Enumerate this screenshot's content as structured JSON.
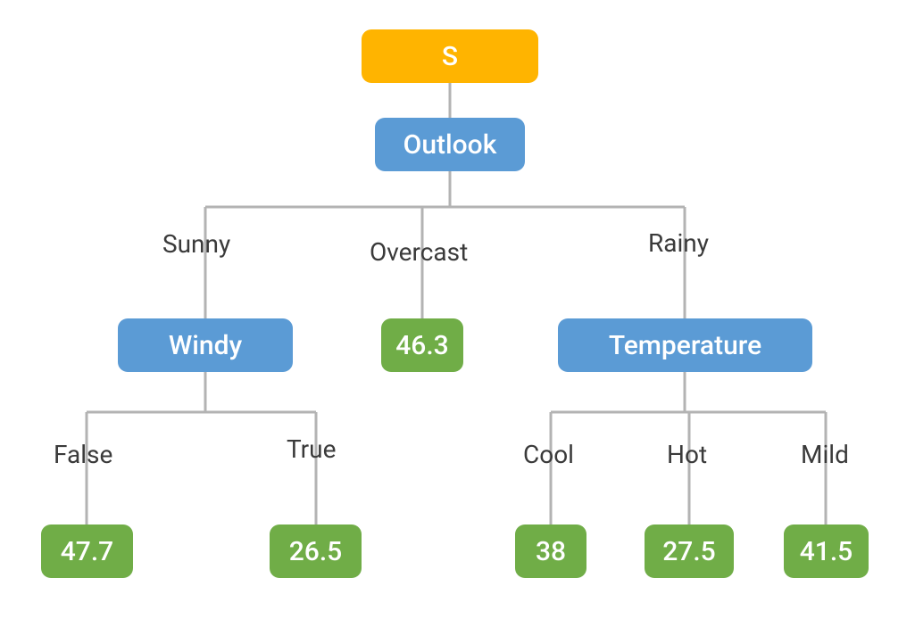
{
  "diagram": {
    "type": "decision-tree",
    "root": {
      "label": "S",
      "attribute": "Outlook",
      "branches": [
        {
          "value": "Sunny",
          "attribute": "Windy",
          "branches": [
            {
              "value": "False",
              "leaf": "47.7"
            },
            {
              "value": "True",
              "leaf": "26.5"
            }
          ]
        },
        {
          "value": "Overcast",
          "leaf": "46.3"
        },
        {
          "value": "Rainy",
          "attribute": "Temperature",
          "branches": [
            {
              "value": "Cool",
              "leaf": "38"
            },
            {
              "value": "Hot",
              "leaf": "27.5"
            },
            {
              "value": "Mild",
              "leaf": "41.5"
            }
          ]
        }
      ]
    }
  },
  "colors": {
    "root": "#ffb400",
    "attribute": "#5b9bd5",
    "leaf": "#70ad47",
    "edge": "#b3b3b3",
    "text_dark": "#3a3a3a",
    "text_light": "#ffffff"
  },
  "nodes": {
    "s_label": "S",
    "outlook_label": "Outlook",
    "windy_label": "Windy",
    "temperature_label": "Temperature",
    "overcast_leaf": "46.3",
    "windy_false_leaf": "47.7",
    "windy_true_leaf": "26.5",
    "temp_cool_leaf": "38",
    "temp_hot_leaf": "27.5",
    "temp_mild_leaf": "41.5"
  },
  "edge_labels": {
    "sunny": "Sunny",
    "overcast": "Overcast",
    "rainy": "Rainy",
    "false": "False",
    "true": "True",
    "cool": "Cool",
    "hot": "Hot",
    "mild": "Mild"
  }
}
